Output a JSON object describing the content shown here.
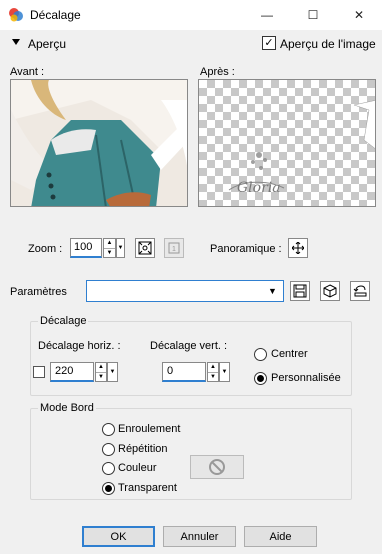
{
  "window": {
    "title": "Décalage",
    "minimize_glyph": "—",
    "maximize_glyph": "☐",
    "close_glyph": "✕"
  },
  "preview": {
    "toggle_label": "Aperçu",
    "preview_on_image_label": "Aperçu de l'image",
    "preview_on_image_checked": true,
    "before_label": "Avant :",
    "after_label": "Après :",
    "watermark_text": "Gloria"
  },
  "zoom": {
    "label": "Zoom :",
    "value": "100",
    "pan_label": "Panoramique :"
  },
  "params": {
    "label": "Paramètres",
    "selected": ""
  },
  "offset_group": {
    "title": "Décalage",
    "horiz_label": "Décalage horiz. :",
    "horiz_value": "220",
    "vert_label": "Décalage vert. :",
    "vert_value": "0",
    "center_label": "Centrer",
    "custom_label": "Personnalisée",
    "selected": "custom"
  },
  "edge_group": {
    "title": "Mode Bord",
    "wrap_label": "Enroulement",
    "repeat_label": "Répétition",
    "color_label": "Couleur",
    "transparent_label": "Transparent",
    "selected": "transparent"
  },
  "buttons": {
    "ok": "OK",
    "cancel": "Annuler",
    "help": "Aide"
  },
  "colors": {
    "accent": "#2f7fd0",
    "teal_corset": "#3f8a8e"
  }
}
